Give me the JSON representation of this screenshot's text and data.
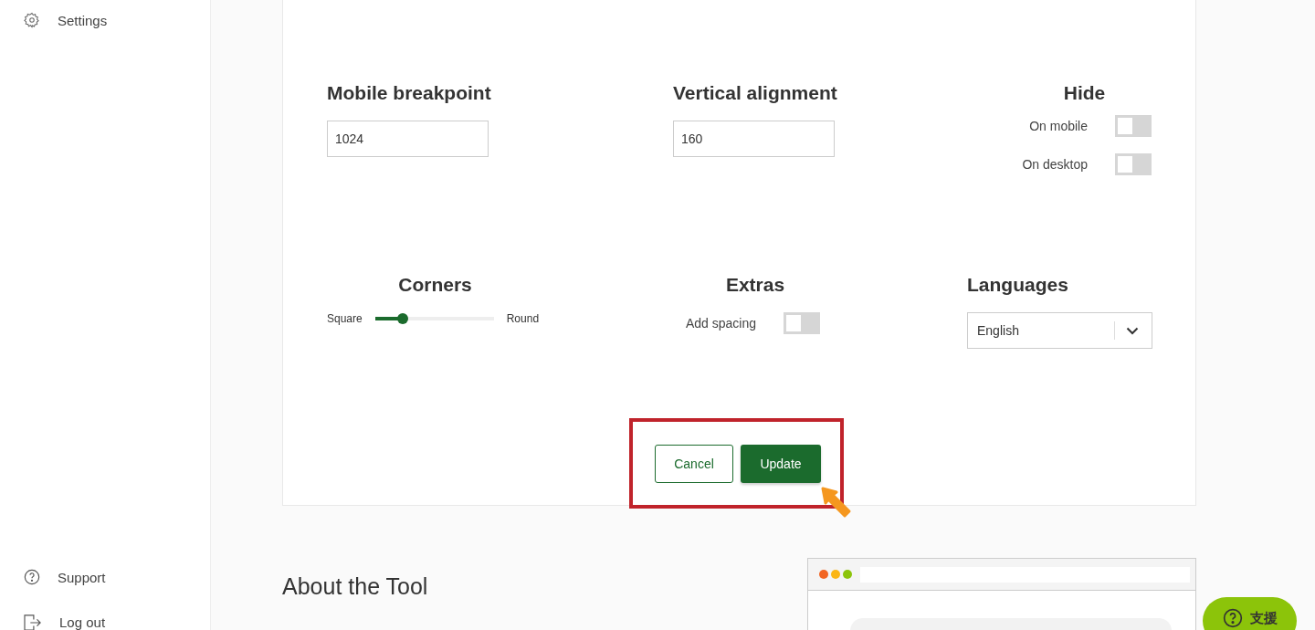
{
  "sidebar": {
    "top_items": [
      {
        "label": "Settings",
        "kind": "gear"
      }
    ],
    "bottom_items": [
      {
        "label": "Support",
        "kind": "help"
      },
      {
        "label": "Log out",
        "kind": "logout"
      }
    ]
  },
  "settings": {
    "row_1": [
      {
        "kind": "input",
        "title": "Mobile breakpoint",
        "value": "1024"
      },
      {
        "kind": "input",
        "title": "Vertical alignment",
        "value": "160"
      },
      {
        "kind": "toggles",
        "title": "Hide",
        "toggles": [
          {
            "label": "On mobile",
            "on": false
          },
          {
            "label": "On desktop",
            "on": false
          }
        ]
      }
    ],
    "row_2": [
      {
        "kind": "slider",
        "title": "Corners",
        "min_label": "Square",
        "max_label": "Round",
        "level": 0.23
      },
      {
        "kind": "toggles",
        "title": "Extras",
        "toggles": [
          {
            "label": "Add spacing",
            "on": false
          }
        ]
      },
      {
        "kind": "select",
        "title": "Languages",
        "value": "English"
      }
    ]
  },
  "buttons": [
    {
      "label": "Cancel",
      "kind": "secondary"
    },
    {
      "label": "Update",
      "kind": "primary"
    }
  ],
  "about": {
    "title": "About the Tool"
  },
  "help_button": {
    "label": "支援"
  }
}
